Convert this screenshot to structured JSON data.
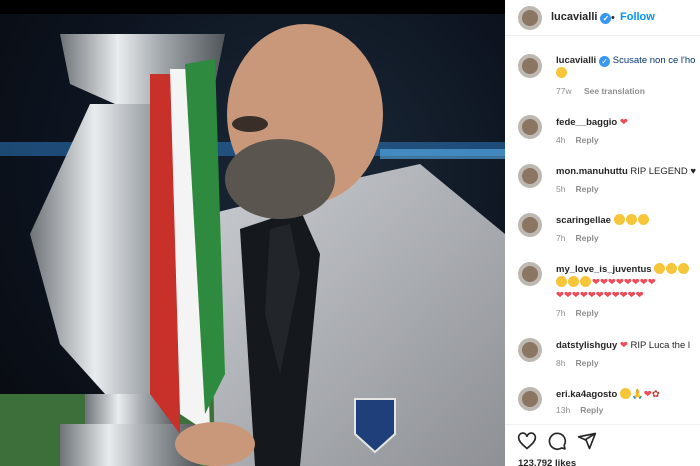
{
  "post": {
    "username": "lucavialli",
    "follow_label": "Follow",
    "caption_username": "lucavialli",
    "caption_text": "Scusate non ce l'ho",
    "caption_age": "77w",
    "see_translation": "See translation"
  },
  "comments": [
    {
      "username": "fede__baggio",
      "text": "",
      "age": "4h",
      "reply": "Reply"
    },
    {
      "username": "mon.manuhuttu",
      "text": "RIP LEGEND",
      "age": "5h",
      "reply": "Reply"
    },
    {
      "username": "scaringellae",
      "text": "",
      "age": "7h",
      "reply": "Reply"
    },
    {
      "username": "my_love_is_juventus",
      "text": "",
      "age": "7h",
      "reply": "Reply"
    },
    {
      "username": "datstylishguy",
      "text": "RIP Luca the l",
      "age": "8h",
      "reply": "Reply"
    },
    {
      "username": "eri.ka4agosto",
      "text": "",
      "age": "13h",
      "reply": "Reply"
    }
  ],
  "likes": "123,792 likes",
  "icons": [
    "heart-icon",
    "comment-icon",
    "share-icon"
  ],
  "colors": {
    "link": "#0095f6",
    "verified": "#3897f0",
    "heart": "#ed4956"
  }
}
